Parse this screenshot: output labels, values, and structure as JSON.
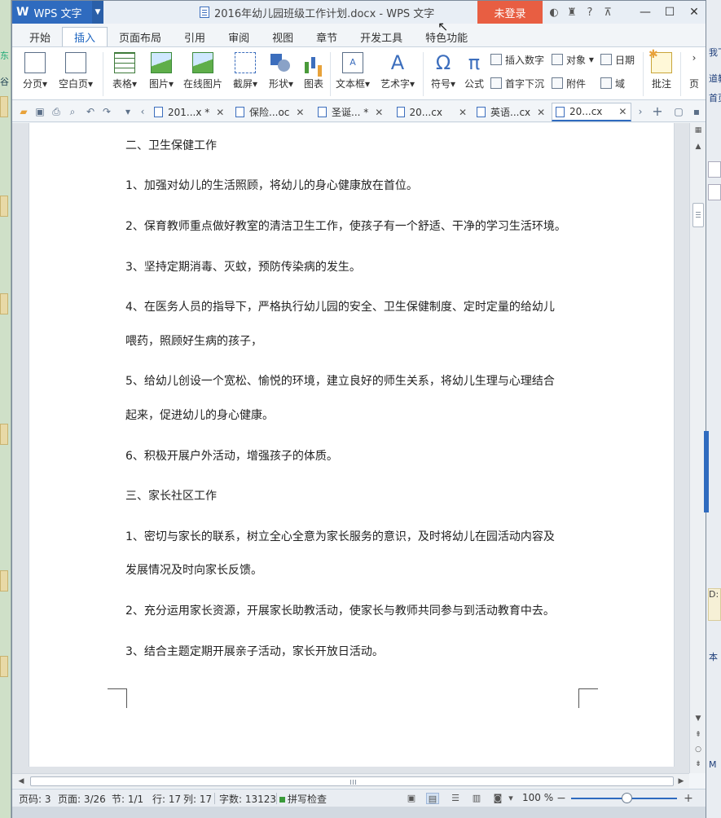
{
  "app": {
    "name": "WPS 文字",
    "window_title": "2016年幼儿园班级工作计划.docx - WPS 文字",
    "login_label": "未登录"
  },
  "ribbon_tabs": [
    {
      "label": "开始"
    },
    {
      "label": "插入"
    },
    {
      "label": "页面布局"
    },
    {
      "label": "引用"
    },
    {
      "label": "审阅"
    },
    {
      "label": "视图"
    },
    {
      "label": "章节"
    },
    {
      "label": "开发工具"
    },
    {
      "label": "特色功能"
    }
  ],
  "ribbon": {
    "page_break": "分页",
    "blank_page": "空白页",
    "table": "表格",
    "picture": "图片",
    "online_picture": "在线图片",
    "screenshot": "截屏",
    "shape": "形状",
    "chart": "图表",
    "textbox": "文本框",
    "wordart": "艺术字",
    "symbol": "符号",
    "formula": "公式",
    "insert_number": "插入数字",
    "object": "对象",
    "date": "日期",
    "drop_cap": "首字下沉",
    "attachment": "附件",
    "field": "域",
    "comment": "批注",
    "more": "页"
  },
  "doc_tabs": [
    {
      "label": "201...x *"
    },
    {
      "label": "保险...oc"
    },
    {
      "label": "圣诞... *"
    },
    {
      "label": "20...cx"
    },
    {
      "label": "英语...cx"
    },
    {
      "label": "20...cx"
    }
  ],
  "document": {
    "paragraphs": [
      "二、卫生保健工作",
      "1、加强对幼儿的生活照顾，将幼儿的身心健康放在首位。",
      "2、保育教师重点做好教室的清洁卫生工作，使孩子有一个舒适、干净的学习生活环境。",
      "3、坚持定期消毒、灭蚊，预防传染病的发生。",
      "4、在医务人员的指导下，严格执行幼儿园的安全、卫生保健制度、定时定量的给幼儿",
      "喂药，照顾好生病的孩子，",
      "5、给幼儿创设一个宽松、愉悦的环境，建立良好的师生关系，将幼儿生理与心理结合",
      "起来，促进幼儿的身心健康。",
      "6、积极开展户外活动，增强孩子的体质。",
      "三、家长社区工作",
      "1、密切与家长的联系，树立全心全意为家长服务的意识，及时将幼儿在园活动内容及",
      "发展情况及时向家长反馈。",
      "2、充分运用家长资源，开展家长助教活动，使家长与教师共同参与到活动教育中去。",
      "3、结合主题定期开展亲子活动，家长开放日活动。"
    ]
  },
  "status": {
    "page_code": "页码: 3",
    "page": "页面: 3/26",
    "section": "节: 1/1",
    "row": "行: 17",
    "col": "列: 17",
    "word_count": "字数: 13123",
    "spell_check": "拼写检查",
    "zoom": "100 %",
    "zoom_percent": 100
  },
  "background": {
    "left_snippet_1": "东",
    "left_snippet_2": "谷",
    "right_snippet_1": "我下",
    "right_snippet_2": "道教",
    "right_snippet_3": "首页",
    "right_snippet_4": "D:",
    "right_snippet_5": "本",
    "right_snippet_6": "M"
  },
  "colors": {
    "app_blue": "#2f6bbf",
    "login_red": "#e85e42",
    "active_tab_text": "#2167c1"
  }
}
